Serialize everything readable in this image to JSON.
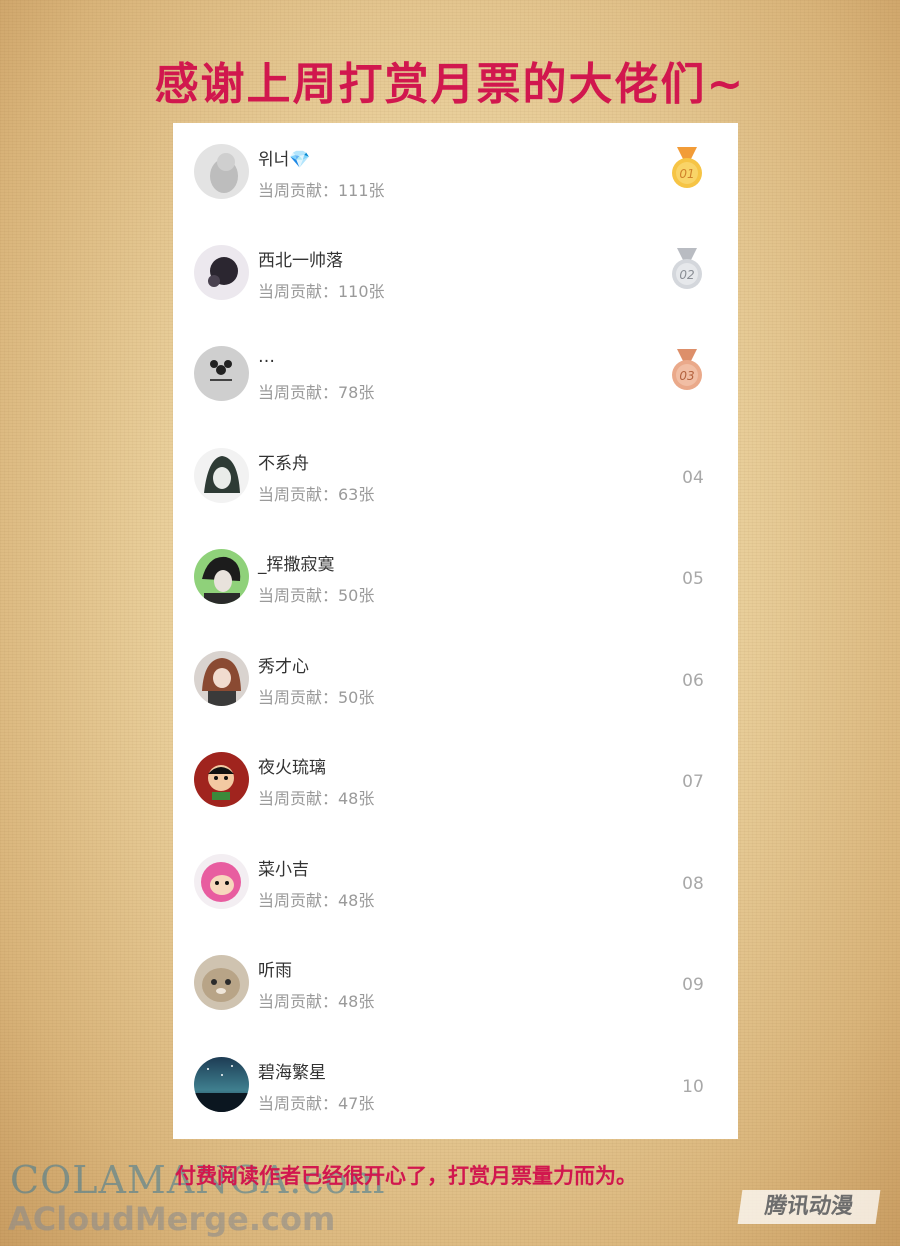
{
  "title": "感谢上周打赏月票的大佬们~",
  "ranking": [
    {
      "name": "위너💎",
      "contribution": "当周贡献：111张",
      "rank": "01",
      "medal": "gold"
    },
    {
      "name": "西北一帅落",
      "contribution": "当周贡献：110张",
      "rank": "02",
      "medal": "silver"
    },
    {
      "name": "…",
      "contribution": "当周贡献：78张",
      "rank": "03",
      "medal": "bronze"
    },
    {
      "name": "不系舟",
      "contribution": "当周贡献：63张",
      "rank": "04"
    },
    {
      "name": "_挥撒寂寞",
      "contribution": "当周贡献：50张",
      "rank": "05"
    },
    {
      "name": "秀才心",
      "contribution": "当周贡献：50张",
      "rank": "06"
    },
    {
      "name": "夜火琉璃",
      "contribution": "当周贡献：48张",
      "rank": "07"
    },
    {
      "name": "菜小吉",
      "contribution": "当周贡献：48张",
      "rank": "08"
    },
    {
      "name": "听雨",
      "contribution": "当周贡献：48张",
      "rank": "09"
    },
    {
      "name": "碧海繁星",
      "contribution": "当周贡献：47张",
      "rank": "10"
    }
  ],
  "footer": "付费阅读作者已经很开心了，打赏月票量力而为。",
  "watermarks": {
    "top": "COLAMANGA.com",
    "bottom": "ACloudMerge.com",
    "stamp": "腾讯动漫"
  },
  "colors": {
    "accent": "#d1174e",
    "gold": "#f5b52e",
    "silver": "#c9ccd1",
    "bronze": "#e7a17f"
  }
}
